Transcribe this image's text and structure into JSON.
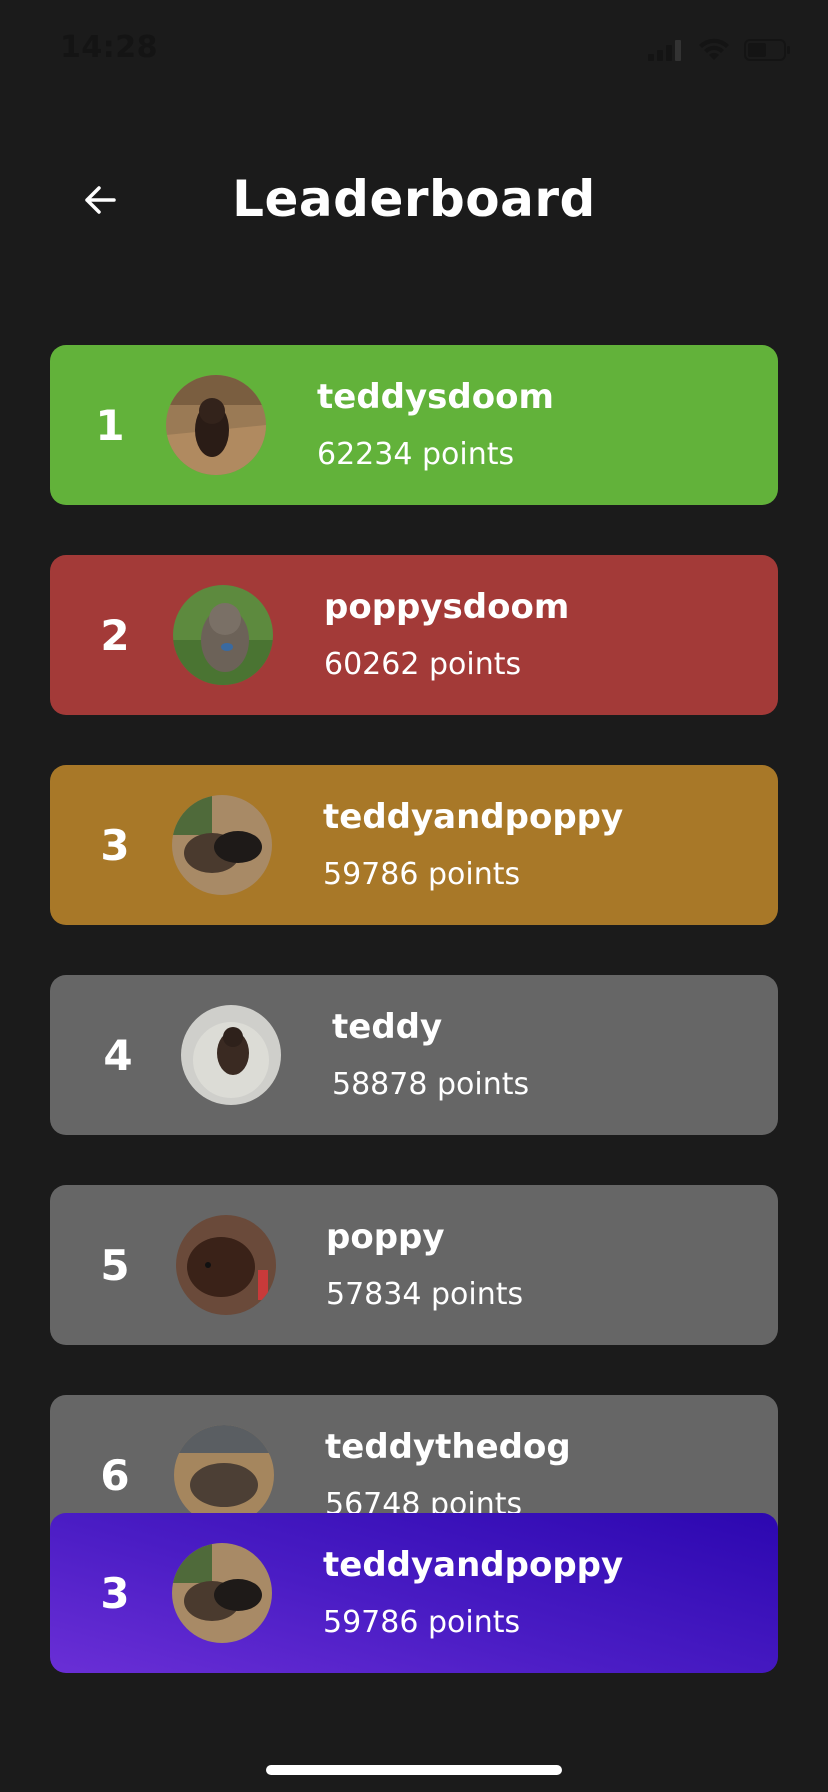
{
  "status_bar": {
    "time": "14:28"
  },
  "header": {
    "title": "Leaderboard"
  },
  "leaderboard": [
    {
      "rank": "1",
      "username": "teddysdoom",
      "points": "62234 points",
      "color": "#62b23a"
    },
    {
      "rank": "2",
      "username": "poppysdoom",
      "points": "60262 points",
      "color": "#a33a38"
    },
    {
      "rank": "3",
      "username": "teddyandpoppy",
      "points": "59786 points",
      "color": "#a87828"
    },
    {
      "rank": "4",
      "username": "teddy",
      "points": "58878 points",
      "color": "#666666"
    },
    {
      "rank": "5",
      "username": "poppy",
      "points": "57834 points",
      "color": "#666666"
    },
    {
      "rank": "6",
      "username": "teddythedog",
      "points": "56748 points",
      "color": "#666666"
    }
  ],
  "current_user": {
    "rank": "3",
    "username": "teddyandpoppy",
    "points": "59786 points",
    "gradient_start": "#6a2fd6",
    "gradient_end": "#2c07b0"
  },
  "icons": {
    "back": "arrow-left-icon",
    "cellular": "cellular-signal-icon",
    "wifi": "wifi-icon",
    "battery": "battery-icon"
  }
}
